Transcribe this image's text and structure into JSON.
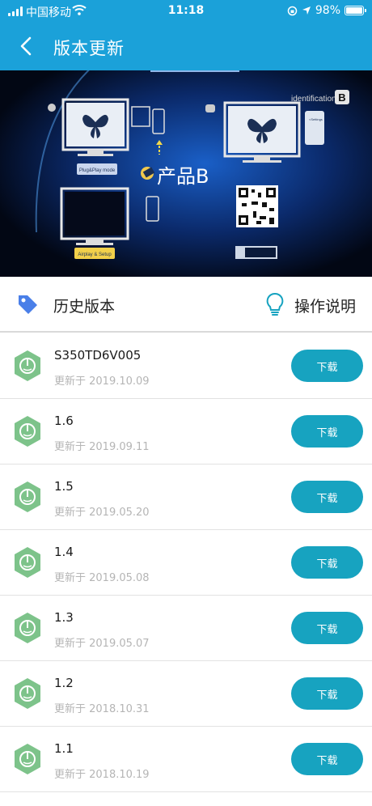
{
  "status": {
    "carrier": "中国移动",
    "time": "11:18",
    "battery": "98%",
    "battery_level": 0.98
  },
  "header": {
    "title": "版本更新",
    "back_icon": "chevron-left-icon",
    "background": "#1ba1d9"
  },
  "banner": {
    "product_label": "产品B",
    "identification_label": "identification:",
    "identification_value": "B",
    "mode_label": "Plug&Play mode",
    "setup_label": "Airplay & Setup",
    "settings_text": "<Settings"
  },
  "section": {
    "left_label": "历史版本",
    "left_icon": "tag-icon",
    "right_label": "操作说明",
    "right_icon": "lightbulb-icon"
  },
  "versions": [
    {
      "name": "S350TD6V005",
      "date": "更新于 2019.10.09",
      "button": "下载"
    },
    {
      "name": "1.6",
      "date": "更新于 2019.09.11",
      "button": "下载"
    },
    {
      "name": "1.5",
      "date": "更新于 2019.05.20",
      "button": "下载"
    },
    {
      "name": "1.4",
      "date": "更新于 2019.05.08",
      "button": "下载"
    },
    {
      "name": "1.3",
      "date": "更新于 2019.05.07",
      "button": "下载"
    },
    {
      "name": "1.2",
      "date": "更新于 2018.10.31",
      "button": "下载"
    },
    {
      "name": "1.1",
      "date": "更新于 2018.10.19",
      "button": "下载"
    }
  ],
  "colors": {
    "accent": "#17a3c0",
    "row_icon": "#7dc38a",
    "tag_icon": "#4a7fe8"
  }
}
